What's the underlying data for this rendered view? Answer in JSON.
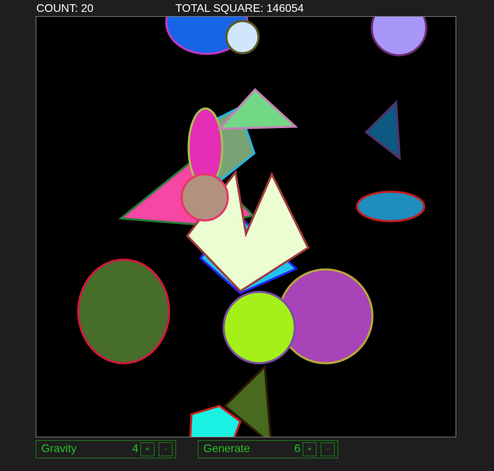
{
  "stats": {
    "count_label": "COUNT: 20",
    "total_label": "TOTAL SQUARE: 146054"
  },
  "controls": {
    "gravity": {
      "label": "Gravity",
      "value": "4",
      "plus": "+",
      "minus": "-"
    },
    "generate": {
      "label": "Generate",
      "value": "6",
      "plus": "+",
      "minus": "-"
    }
  },
  "colors": {
    "page_background": "#1e1e1e",
    "canvas_background": "#000000",
    "stat_text": "#ffffff",
    "control_text": "#22c322",
    "control_border": "#1d7a1d"
  }
}
